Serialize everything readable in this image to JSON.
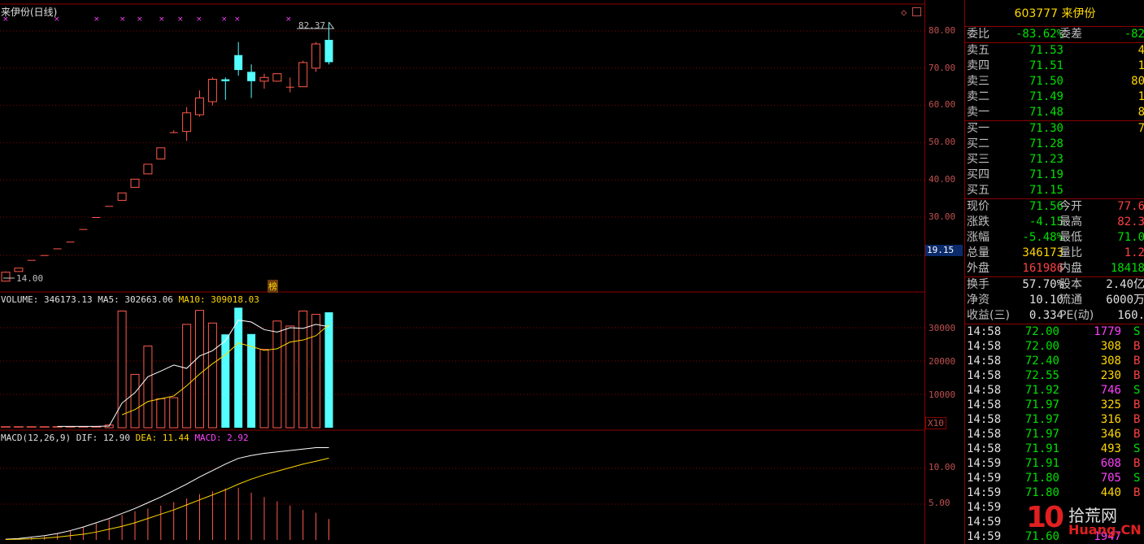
{
  "chart": {
    "title": "来伊份(日线)",
    "high_marker": "82.37",
    "low_marker": "14.00",
    "badge": "榜",
    "volume_header": {
      "label": "VOLUME: 346173.13",
      "ma5": "MA5: 302663.06",
      "ma10": "MA10: 309018.03"
    },
    "macd_header": {
      "label": "MACD(12,26,9)",
      "dif": "DIF: 12.90",
      "dea": "DEA: 11.44",
      "macd": "MACD: 2.92"
    },
    "price_axis": [
      "80.00",
      "70.00",
      "60.00",
      "50.00",
      "40.00",
      "30.00"
    ],
    "price_box": "19.15",
    "volume_axis": [
      "30000",
      "20000",
      "10000"
    ],
    "volume_unit": "X10",
    "macd_axis": [
      "10.00",
      "5.00"
    ],
    "colors": {
      "up": "#ff5a4a",
      "down": "#54ffff",
      "grid": "#8b0000",
      "ma5": "#ffffff",
      "ma10": "#ffd700"
    }
  },
  "chart_data": [
    {
      "type": "candlestick",
      "title": "来伊份(日线)",
      "price_axis_ticks": [
        30,
        40,
        50,
        60,
        70,
        80
      ],
      "candles": [
        {
          "open": 12.8,
          "close": 15.2,
          "high": 15.4,
          "low": 12.7
        },
        {
          "open": 15.4,
          "close": 16.3,
          "high": 16.3,
          "low": 15.4
        },
        {
          "open": 18.5,
          "close": 18.5,
          "high": 18.5,
          "low": 18.5
        },
        {
          "open": 19.8,
          "close": 19.8,
          "high": 19.8,
          "low": 19.8
        },
        {
          "open": 21.6,
          "close": 21.6,
          "high": 21.6,
          "low": 21.6
        },
        {
          "open": 23.4,
          "close": 23.4,
          "high": 23.4,
          "low": 23.4
        },
        {
          "open": 26.8,
          "close": 26.8,
          "high": 26.8,
          "low": 26.8
        },
        {
          "open": 30.0,
          "close": 30.0,
          "high": 30.0,
          "low": 30.0
        },
        {
          "open": 33.0,
          "close": 33.0,
          "high": 33.0,
          "low": 33.0
        },
        {
          "open": 34.5,
          "close": 36.5,
          "high": 36.5,
          "low": 34.5
        },
        {
          "open": 38.0,
          "close": 40.2,
          "high": 40.2,
          "low": 38.0
        },
        {
          "open": 41.6,
          "close": 44.2,
          "high": 44.2,
          "low": 41.6
        },
        {
          "open": 45.6,
          "close": 48.6,
          "high": 48.6,
          "low": 45.6
        },
        {
          "open": 52.8,
          "close": 52.8,
          "high": 53.3,
          "low": 52.8
        },
        {
          "open": 53.0,
          "close": 58.0,
          "high": 59.5,
          "low": 50.5
        },
        {
          "open": 57.5,
          "close": 62.0,
          "high": 64.0,
          "low": 57.0
        },
        {
          "open": 61.0,
          "close": 67.0,
          "high": 67.5,
          "low": 60.0
        },
        {
          "open": 67.0,
          "close": 66.5,
          "high": 67.5,
          "low": 61.5
        },
        {
          "open": 73.5,
          "close": 69.5,
          "high": 77.0,
          "low": 68.0
        },
        {
          "open": 69.0,
          "close": 66.5,
          "high": 71.0,
          "low": 62.0
        },
        {
          "open": 66.5,
          "close": 67.5,
          "high": 68.5,
          "low": 64.5
        },
        {
          "open": 66.5,
          "close": 68.5,
          "high": 68.5,
          "low": 66.5
        },
        {
          "open": 65.0,
          "close": 65.0,
          "high": 67.5,
          "low": 63.5
        },
        {
          "open": 65.0,
          "close": 71.5,
          "high": 72.0,
          "low": 65.0
        },
        {
          "open": 70.0,
          "close": 76.5,
          "high": 77.0,
          "low": 69.0
        },
        {
          "open": 77.6,
          "close": 71.6,
          "high": 82.37,
          "low": 71.0
        }
      ],
      "markers": {
        "high": 82.37,
        "low": 14.0
      }
    },
    {
      "type": "bar",
      "title": "VOLUME: 346173.13",
      "axis_ticks": [
        10000,
        20000,
        30000
      ],
      "unit": "X10",
      "series": [
        {
          "name": "VOLUME",
          "values": [
            400,
            400,
            400,
            400,
            400,
            400,
            400,
            400,
            800,
            35000,
            16000,
            24500,
            8700,
            9000,
            31000,
            35200,
            31400,
            28000,
            36000,
            28100,
            23500,
            32000,
            30500,
            35000,
            34000,
            34617
          ]
        },
        {
          "name": "MA5",
          "values": [
            null,
            null,
            null,
            null,
            400,
            400,
            400,
            400,
            480,
            7400,
            10500,
            15300,
            17000,
            18800,
            17800,
            21500,
            23100,
            26100,
            32300,
            31700,
            29400,
            28700,
            30000,
            29800,
            31000,
            30266
          ]
        },
        {
          "name": "MA10",
          "values": [
            null,
            null,
            null,
            null,
            null,
            null,
            null,
            null,
            null,
            3900,
            5450,
            7860,
            8700,
            9530,
            12600,
            16100,
            19200,
            21900,
            25400,
            24400,
            23200,
            23700,
            25700,
            26300,
            27600,
            30902
          ]
        }
      ]
    },
    {
      "type": "line",
      "title": "MACD(12,26,9)",
      "axis_ticks": [
        5,
        10
      ],
      "series": [
        {
          "name": "DIF",
          "values": [
            0.1,
            0.2,
            0.4,
            0.6,
            0.9,
            1.3,
            1.8,
            2.4,
            3.0,
            3.7,
            4.4,
            5.2,
            6.0,
            6.9,
            7.8,
            8.8,
            9.7,
            10.6,
            11.4,
            11.8,
            12.1,
            12.3,
            12.5,
            12.7,
            12.9,
            12.9
          ]
        },
        {
          "name": "DEA",
          "values": [
            0.05,
            0.1,
            0.15,
            0.25,
            0.4,
            0.6,
            0.8,
            1.1,
            1.5,
            1.9,
            2.4,
            3.0,
            3.6,
            4.2,
            4.9,
            5.6,
            6.3,
            7.0,
            7.8,
            8.5,
            9.1,
            9.6,
            10.1,
            10.6,
            11.0,
            11.44
          ]
        },
        {
          "name": "MACD",
          "values": [
            0.1,
            0.2,
            0.4,
            0.6,
            0.9,
            1.3,
            1.8,
            2.3,
            2.9,
            3.5,
            4.0,
            4.4,
            4.8,
            5.3,
            5.8,
            6.4,
            6.8,
            7.2,
            7.3,
            6.6,
            6.0,
            5.4,
            4.8,
            4.2,
            3.8,
            2.92
          ]
        }
      ]
    }
  ],
  "panel": {
    "title": "603777 来伊份",
    "weibi": {
      "label": "委比",
      "value": "-83.62%",
      "label2": "委差",
      "value2": "-82"
    },
    "asks": [
      {
        "label": "卖五",
        "price": "71.53",
        "vol": "4"
      },
      {
        "label": "卖四",
        "price": "71.51",
        "vol": "1"
      },
      {
        "label": "卖三",
        "price": "71.50",
        "vol": "80"
      },
      {
        "label": "卖二",
        "price": "71.49",
        "vol": "1"
      },
      {
        "label": "卖一",
        "price": "71.48",
        "vol": "8"
      }
    ],
    "bids": [
      {
        "label": "买一",
        "price": "71.30",
        "vol": "7"
      },
      {
        "label": "买二",
        "price": "71.28",
        "vol": ""
      },
      {
        "label": "买三",
        "price": "71.23",
        "vol": ""
      },
      {
        "label": "买四",
        "price": "71.19",
        "vol": ""
      },
      {
        "label": "买五",
        "price": "71.15",
        "vol": ""
      }
    ],
    "stats": [
      {
        "l1": "现价",
        "v1": "71.56",
        "c1": "green",
        "l2": "今开",
        "v2": "77.6",
        "c2": "red"
      },
      {
        "l1": "涨跌",
        "v1": "-4.15",
        "c1": "green",
        "l2": "最高",
        "v2": "82.3",
        "c2": "red"
      },
      {
        "l1": "涨幅",
        "v1": "-5.48%",
        "c1": "green",
        "l2": "最低",
        "v2": "71.0",
        "c2": "green"
      },
      {
        "l1": "总量",
        "v1": "346173",
        "c1": "yellow",
        "l2": "量比",
        "v2": "1.2",
        "c2": "red"
      },
      {
        "l1": "外盘",
        "v1": "161986",
        "c1": "red",
        "l2": "内盘",
        "v2": "18418",
        "c2": "green"
      }
    ],
    "fundamentals": [
      {
        "l1": "换手",
        "v1": "57.70%",
        "l2": "股本",
        "v2": "2.40亿"
      },
      {
        "l1": "净资",
        "v1": "10.10",
        "l2": "流通",
        "v2": "6000万"
      },
      {
        "l1": "收益(三)",
        "v1": "0.334",
        "l2": "PE(动)",
        "v2": "160."
      }
    ],
    "ticks": [
      {
        "time": "14:58",
        "price": "72.00",
        "vol": "1779",
        "vc": "magenta",
        "bs": "S",
        "bc": "green"
      },
      {
        "time": "14:58",
        "price": "72.00",
        "vol": "308",
        "vc": "yellow",
        "bs": "B",
        "bc": "red"
      },
      {
        "time": "14:58",
        "price": "72.40",
        "vol": "308",
        "vc": "yellow",
        "bs": "B",
        "bc": "red"
      },
      {
        "time": "14:58",
        "price": "72.55",
        "vol": "230",
        "vc": "yellow",
        "bs": "B",
        "bc": "red"
      },
      {
        "time": "14:58",
        "price": "71.92",
        "vol": "746",
        "vc": "magenta",
        "bs": "S",
        "bc": "green"
      },
      {
        "time": "14:58",
        "price": "71.97",
        "vol": "325",
        "vc": "yellow",
        "bs": "B",
        "bc": "red"
      },
      {
        "time": "14:58",
        "price": "71.97",
        "vol": "316",
        "vc": "yellow",
        "bs": "B",
        "bc": "red"
      },
      {
        "time": "14:58",
        "price": "71.97",
        "vol": "346",
        "vc": "yellow",
        "bs": "B",
        "bc": "red"
      },
      {
        "time": "14:58",
        "price": "71.91",
        "vol": "493",
        "vc": "yellow",
        "bs": "S",
        "bc": "green"
      },
      {
        "time": "14:59",
        "price": "71.91",
        "vol": "608",
        "vc": "magenta",
        "bs": "B",
        "bc": "red"
      },
      {
        "time": "14:59",
        "price": "71.80",
        "vol": "705",
        "vc": "magenta",
        "bs": "S",
        "bc": "green"
      },
      {
        "time": "14:59",
        "price": "71.80",
        "vol": "440",
        "vc": "yellow",
        "bs": "B",
        "bc": "red"
      },
      {
        "time": "14:59",
        "price": "",
        "vol": "",
        "vc": "yellow",
        "bs": "",
        "bc": "red"
      },
      {
        "time": "14:59",
        "price": "",
        "vol": "",
        "vc": "yellow",
        "bs": "",
        "bc": "red"
      },
      {
        "time": "14:59",
        "price": "71.60",
        "vol": "1947",
        "vc": "magenta",
        "bs": "",
        "bc": "red"
      }
    ]
  },
  "watermark": {
    "digits": "10",
    "text": "拾荒网",
    "domain": "Huang.CN"
  }
}
